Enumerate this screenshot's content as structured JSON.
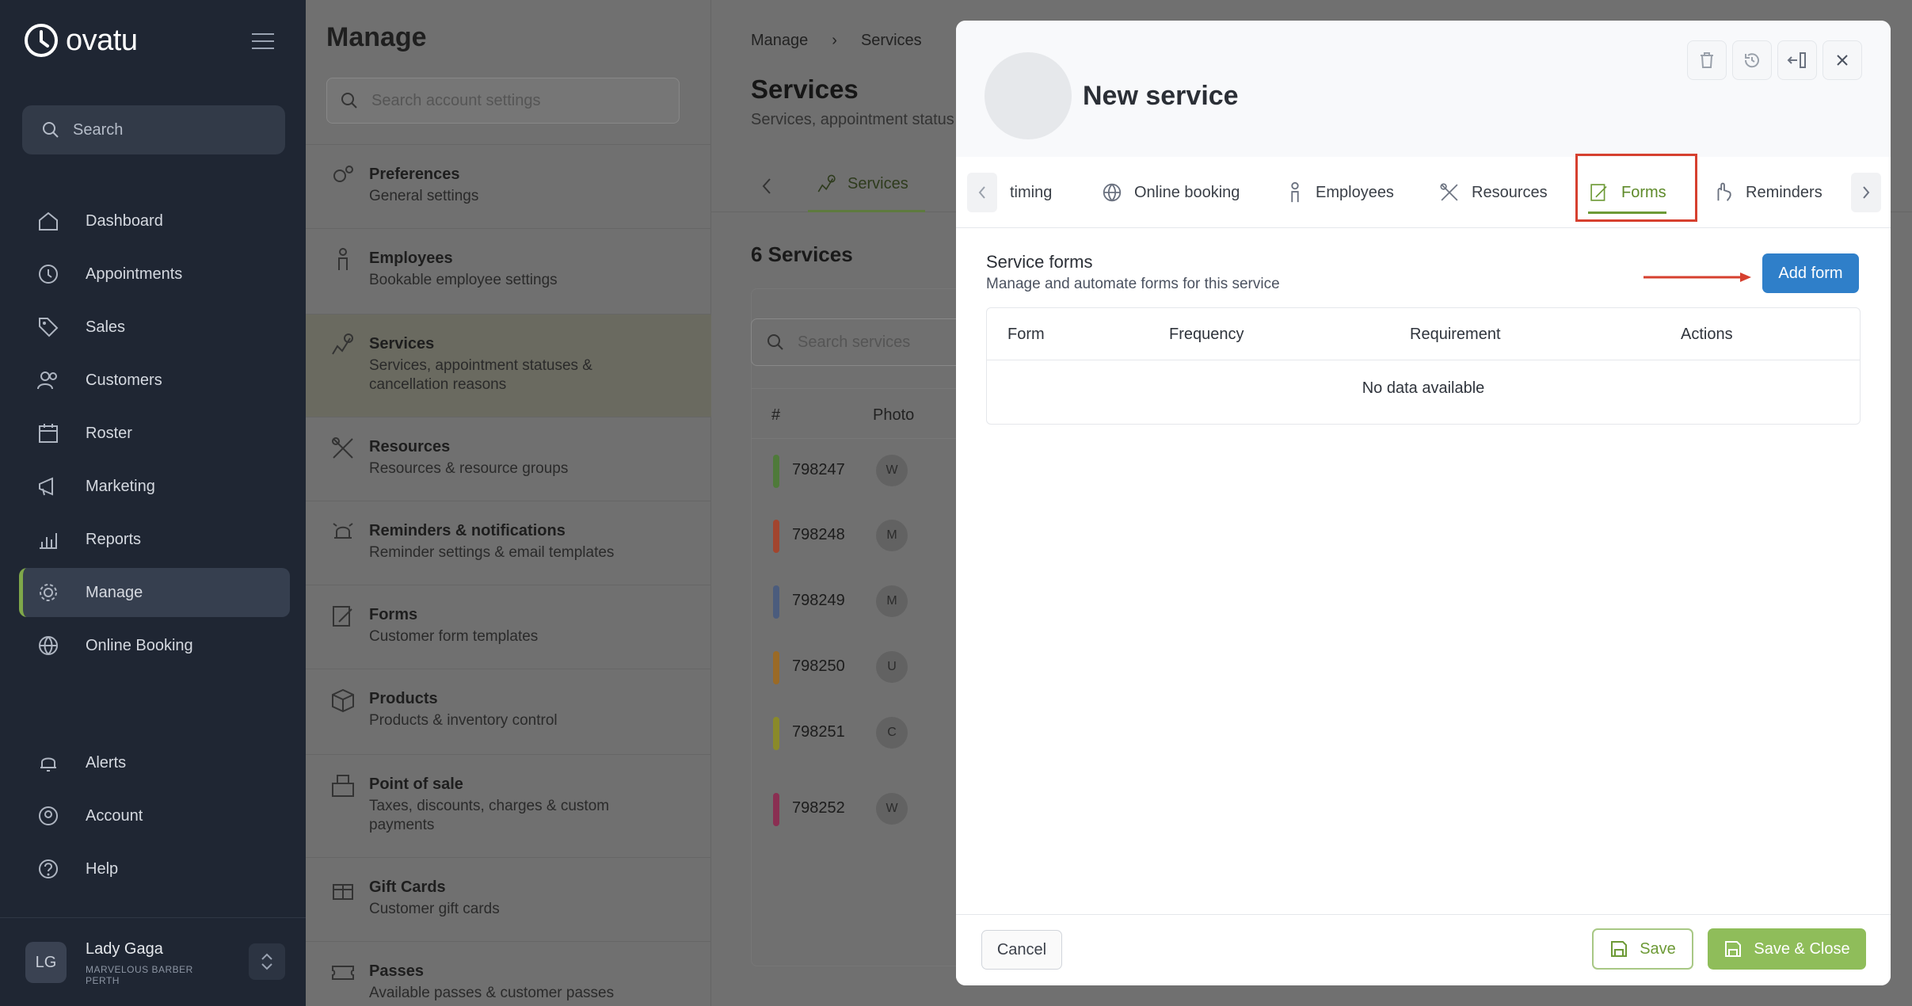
{
  "app": {
    "brand": "ovatu"
  },
  "sidebar": {
    "search_placeholder": "Search",
    "items": [
      {
        "label": "Dashboard",
        "icon": "home-icon"
      },
      {
        "label": "Appointments",
        "icon": "clock-icon"
      },
      {
        "label": "Sales",
        "icon": "tag-icon"
      },
      {
        "label": "Customers",
        "icon": "users-icon"
      },
      {
        "label": "Roster",
        "icon": "calendar-icon"
      },
      {
        "label": "Marketing",
        "icon": "megaphone-icon"
      },
      {
        "label": "Reports",
        "icon": "chart-icon"
      },
      {
        "label": "Manage",
        "icon": "gear-icon",
        "active": true
      },
      {
        "label": "Online Booking",
        "icon": "globe-icon"
      }
    ],
    "bottom_items": [
      {
        "label": "Alerts",
        "icon": "bell-icon"
      },
      {
        "label": "Account",
        "icon": "account-icon"
      },
      {
        "label": "Help",
        "icon": "help-icon"
      }
    ],
    "user": {
      "initials": "LG",
      "name": "Lady Gaga",
      "org": "MARVELOUS BARBER PERTH"
    }
  },
  "manage": {
    "title": "Manage",
    "search_placeholder": "Search account settings",
    "items": [
      {
        "title": "Preferences",
        "sub": "General settings"
      },
      {
        "title": "Employees",
        "sub": "Bookable employee settings"
      },
      {
        "title": "Services",
        "sub": "Services, appointment statuses & cancellation reasons",
        "selected": true
      },
      {
        "title": "Resources",
        "sub": "Resources & resource groups"
      },
      {
        "title": "Reminders & notifications",
        "sub": "Reminder settings & email templates"
      },
      {
        "title": "Forms",
        "sub": "Customer form templates"
      },
      {
        "title": "Products",
        "sub": "Products & inventory control"
      },
      {
        "title": "Point of sale",
        "sub": "Taxes, discounts, charges & custom payments"
      },
      {
        "title": "Gift Cards",
        "sub": "Customer gift cards"
      },
      {
        "title": "Passes",
        "sub": "Available passes & customer passes"
      }
    ]
  },
  "services": {
    "breadcrumb": [
      "Manage",
      "Services"
    ],
    "title": "Services",
    "subtitle": "Services, appointment status",
    "tab": "Services",
    "count": "6 Services",
    "search_placeholder": "Search services",
    "columns": [
      "#",
      "Photo"
    ],
    "rows": [
      {
        "id": "798247",
        "photo": "W",
        "color": "#4f7a3a"
      },
      {
        "id": "798248",
        "photo": "M",
        "color": "#a2452e"
      },
      {
        "id": "798249",
        "photo": "M",
        "color": "#4b5c7d"
      },
      {
        "id": "798250",
        "photo": "U",
        "color": "#9a6a26"
      },
      {
        "id": "798251",
        "photo": "C",
        "color": "#8a8a2a"
      },
      {
        "id": "798252",
        "photo": "W",
        "color": "#8a2f52"
      }
    ]
  },
  "modal": {
    "title": "New service",
    "tabs": [
      {
        "label": "timing"
      },
      {
        "label": "Online booking",
        "icon": "globe-icon"
      },
      {
        "label": "Employees",
        "icon": "person-icon"
      },
      {
        "label": "Resources",
        "icon": "tools-icon"
      },
      {
        "label": "Forms",
        "icon": "form-icon",
        "active": true
      },
      {
        "label": "Reminders",
        "icon": "hand-icon"
      }
    ],
    "section_title": "Service forms",
    "section_sub": "Manage and automate forms for this service",
    "add_label": "Add form",
    "table": {
      "columns": [
        "Form",
        "Frequency",
        "Requirement",
        "Actions"
      ],
      "empty": "No data available"
    },
    "footer": {
      "cancel": "Cancel",
      "save": "Save",
      "save_close": "Save & Close"
    }
  },
  "colors": {
    "accent": "#6d9a36",
    "primary_button": "#2f7fc9",
    "highlight": "#d6402f"
  }
}
